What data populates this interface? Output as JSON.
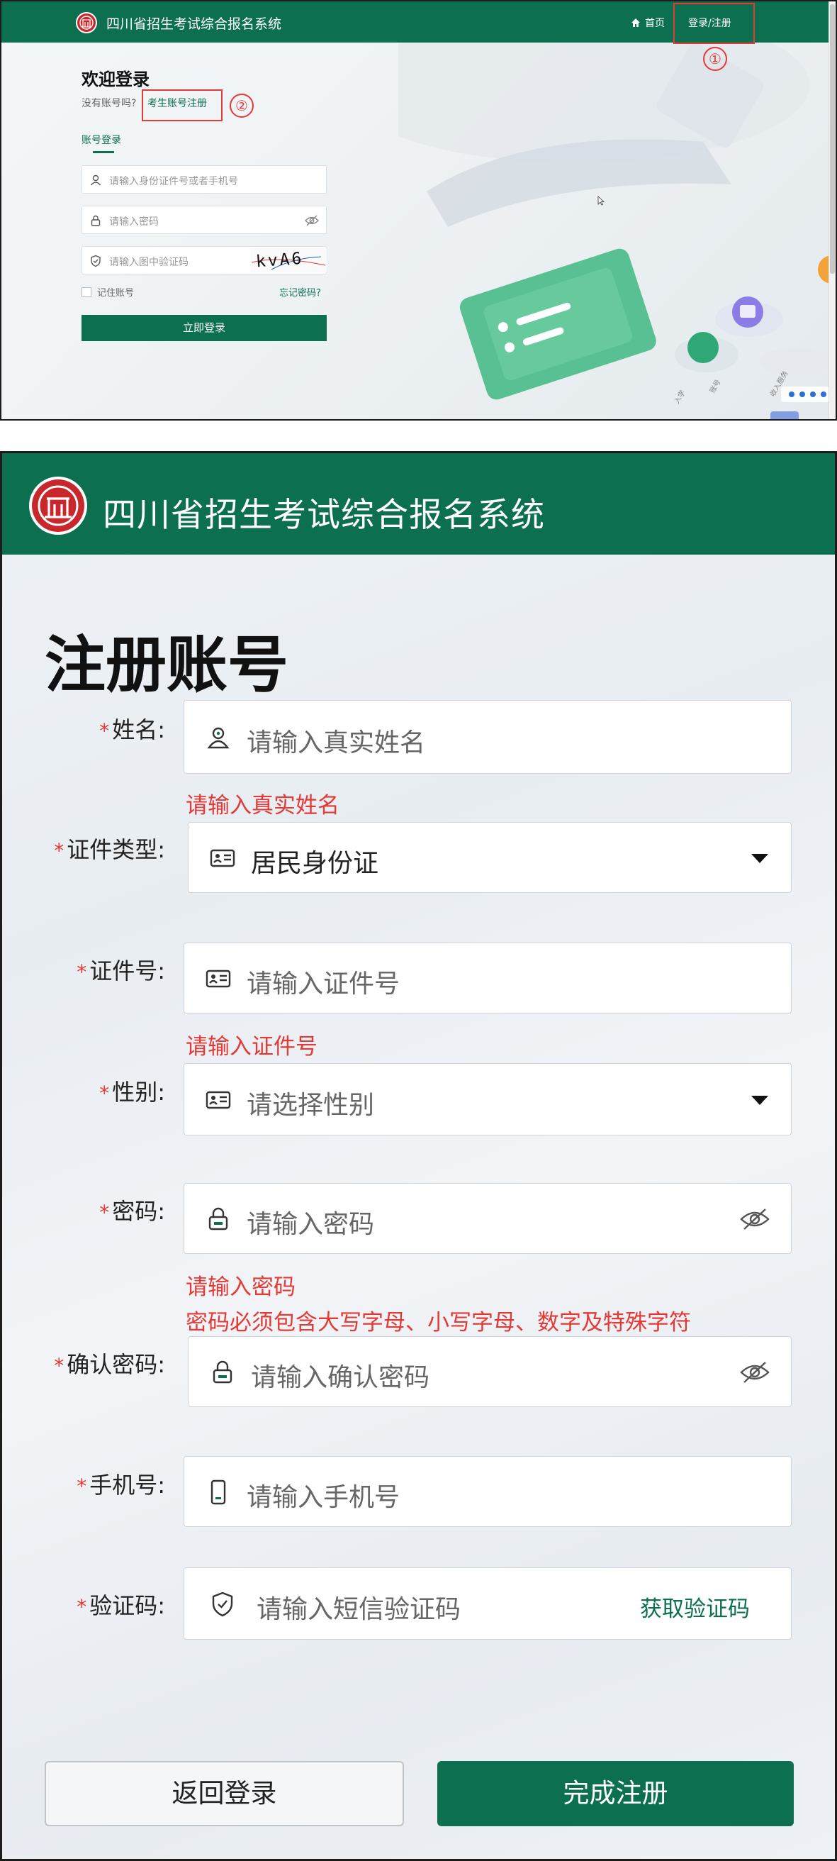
{
  "colors": {
    "brand": "#0b6f50",
    "error": "#e53935",
    "annotation": "#e53935"
  },
  "login_screen": {
    "header": {
      "title": "四川省招生考试综合报名系统",
      "home_label": "首页",
      "login_register_label": "登录/注册"
    },
    "annotations": {
      "mark_1": "①",
      "mark_2": "②"
    },
    "welcome": "欢迎登录",
    "no_account": "没有账号吗?",
    "register_link": "考生账号注册",
    "tab_account": "账号登录",
    "id_placeholder": "请输入身份证件号或者手机号",
    "password_placeholder": "请输入密码",
    "captcha_placeholder": "请输入图中验证码",
    "captcha_text": "kvA6",
    "remember_label": "记住账号",
    "forgot_link": "忘记密码?",
    "submit_label": "立即登录",
    "icons": [
      "user-icon",
      "lock-icon",
      "shield-icon",
      "eye-off-icon",
      "home-icon"
    ]
  },
  "register_screen": {
    "header_title": "四川省招生考试综合报名系统",
    "heading": "注册账号",
    "required_mark": "*",
    "fields": {
      "name": {
        "label": "姓名:",
        "placeholder": "请输入真实姓名",
        "error": "请输入真实姓名"
      },
      "id_type": {
        "label": "证件类型:",
        "value": "居民身份证"
      },
      "id_number": {
        "label": "证件号:",
        "placeholder": "请输入证件号",
        "error": "请输入证件号"
      },
      "gender": {
        "label": "性别:",
        "placeholder": "请选择性别"
      },
      "password": {
        "label": "密码:",
        "placeholder": "请输入密码",
        "error": "请输入密码",
        "error_rule": "密码必须包含大写字母、小写字母、数字及特殊字符"
      },
      "confirm_password": {
        "label": "确认密码:",
        "placeholder": "请输入确认密码"
      },
      "phone": {
        "label": "手机号:",
        "placeholder": "请输入手机号"
      },
      "sms_code": {
        "label": "验证码:",
        "placeholder": "请输入短信验证码",
        "get_code_label": "获取验证码"
      }
    },
    "buttons": {
      "back_label": "返回登录",
      "finish_label": "完成注册"
    },
    "icons": [
      "user-icon",
      "id-card-icon",
      "lock-icon",
      "eye-off-icon",
      "phone-icon",
      "shield-check-icon",
      "chevron-down-icon"
    ]
  }
}
